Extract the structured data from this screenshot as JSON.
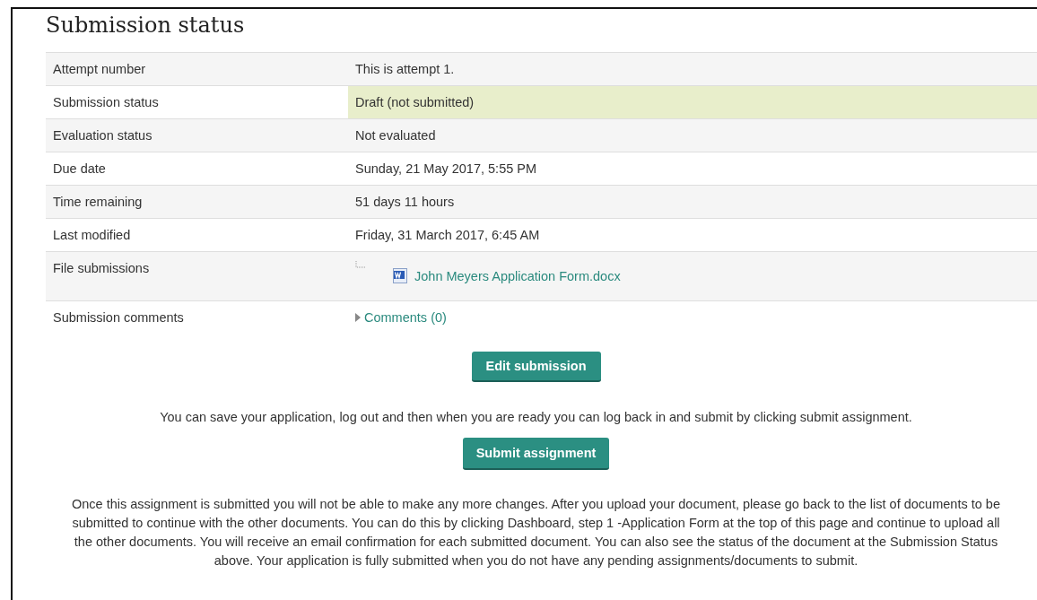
{
  "title": "Submission status",
  "rows": [
    {
      "label": "Attempt number",
      "kind": "text",
      "value": "This is attempt 1.",
      "highlighted": false
    },
    {
      "label": "Submission status",
      "kind": "text",
      "value": "Draft (not submitted)",
      "highlighted": true
    },
    {
      "label": "Evaluation status",
      "kind": "text",
      "value": "Not evaluated",
      "highlighted": false
    },
    {
      "label": "Due date",
      "kind": "text",
      "value": "Sunday, 21 May 2017, 5:55 PM",
      "highlighted": false
    },
    {
      "label": "Time remaining",
      "kind": "text",
      "value": "51 days 11 hours",
      "highlighted": false
    },
    {
      "label": "Last modified",
      "kind": "text",
      "value": "Friday, 31 March 2017, 6:45 AM",
      "highlighted": false
    },
    {
      "label": "File submissions",
      "kind": "file",
      "value": "John Meyers Application Form.docx",
      "highlighted": false
    },
    {
      "label": "Submission comments",
      "kind": "comments",
      "value": "Comments (0)",
      "highlighted": false
    }
  ],
  "edit_button": "Edit submission",
  "save_note": "You can save your application, log out and then when you are ready you can log back in and submit by clicking submit assignment.",
  "submit_button": "Submit assignment",
  "final_note": "Once this assignment is submitted you will not be able to make any more changes. After you upload your document, please go back to the list of documents to be submitted to continue with the other documents. You can do this by clicking Dashboard, step 1 -Application Form at the top of this page and continue to upload all the other documents. You will receive an email confirmation for each submitted document. You can also see the status of the document at the Submission Status above. Your application is fully submitted when you do not have any pending assignments/documents to submit."
}
